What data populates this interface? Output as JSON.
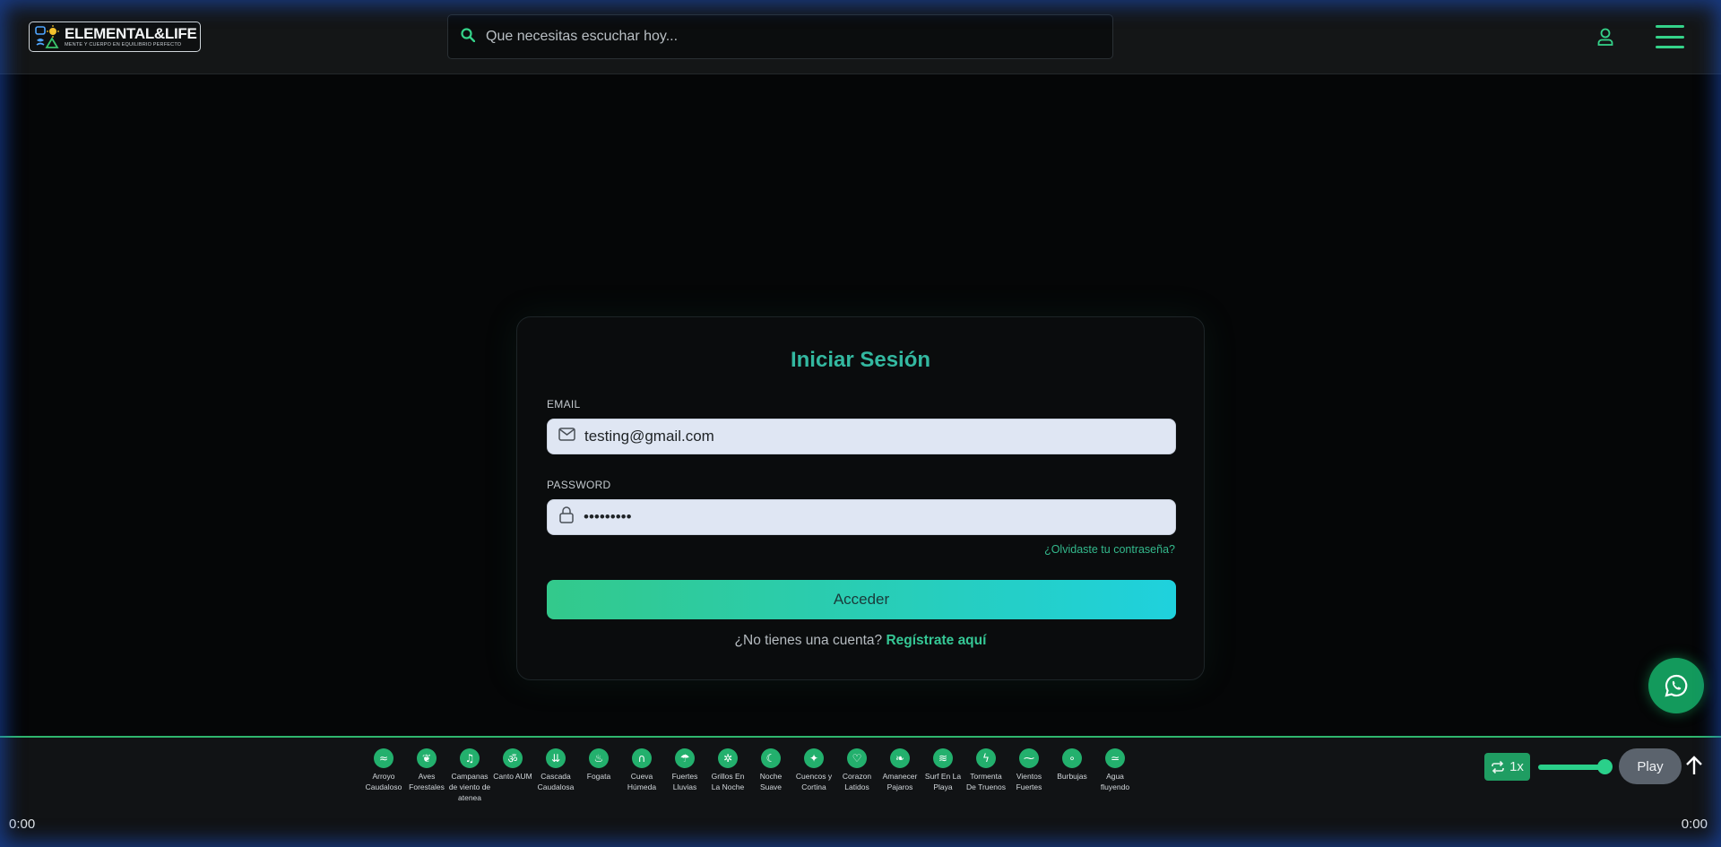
{
  "header": {
    "logo_title": "ELEMENTAL&LIFE",
    "logo_subtitle": "MENTE Y CUERPO EN EQUILIBRIO PERFECTO",
    "search_placeholder": "Que necesitas escuchar hoy..."
  },
  "login": {
    "title": "Iniciar Sesión",
    "email_label": "EMAIL",
    "email_value": "testing@gmail.com",
    "password_label": "PASSWORD",
    "password_value": "•••••••••",
    "forgot_link": "¿Olvidaste tu contraseña?",
    "submit_label": "Acceder",
    "register_prompt": "¿No tienes una cuenta?",
    "register_link": "Regístrate aquí"
  },
  "player": {
    "sounds": [
      {
        "label": "Arroyo Caudaloso",
        "icon": "stream-icon"
      },
      {
        "label": "Aves Forestales",
        "icon": "bird-icon"
      },
      {
        "label": "Campanas de viento de atenea",
        "icon": "wind-chime-icon"
      },
      {
        "label": "Canto AUM",
        "icon": "om-icon"
      },
      {
        "label": "Cascada Caudalosa",
        "icon": "waterfall-icon"
      },
      {
        "label": "Fogata",
        "icon": "campfire-icon"
      },
      {
        "label": "Cueva Húmeda",
        "icon": "cave-icon"
      },
      {
        "label": "Fuertes Lluvias",
        "icon": "heavy-rain-icon"
      },
      {
        "label": "Grillos En La Noche",
        "icon": "cricket-icon"
      },
      {
        "label": "Noche Suave",
        "icon": "moon-icon"
      },
      {
        "label": "Cuencos y Cortina",
        "icon": "sparkle-icon"
      },
      {
        "label": "Corazon Latidos",
        "icon": "heart-icon"
      },
      {
        "label": "Amanecer Pajaros",
        "icon": "sunrise-bird-icon"
      },
      {
        "label": "Surf En La Playa",
        "icon": "waves-icon"
      },
      {
        "label": "Tormenta De Truenos",
        "icon": "thunder-icon"
      },
      {
        "label": "Vientos Fuertes",
        "icon": "wind-icon"
      },
      {
        "label": "Burbujas",
        "icon": "bubbles-icon"
      },
      {
        "label": "Agua fluyendo",
        "icon": "flowing-water-icon"
      }
    ],
    "repeat_label": "1x",
    "play_label": "Play",
    "time_start": "0:00",
    "time_end": "0:00",
    "volume_level": 0.8
  },
  "colors": {
    "accent_green": "#2fb56d",
    "title_teal": "#33b8a0",
    "button_gradient_start": "#33c98b",
    "button_gradient_end": "#1fd1dd"
  }
}
